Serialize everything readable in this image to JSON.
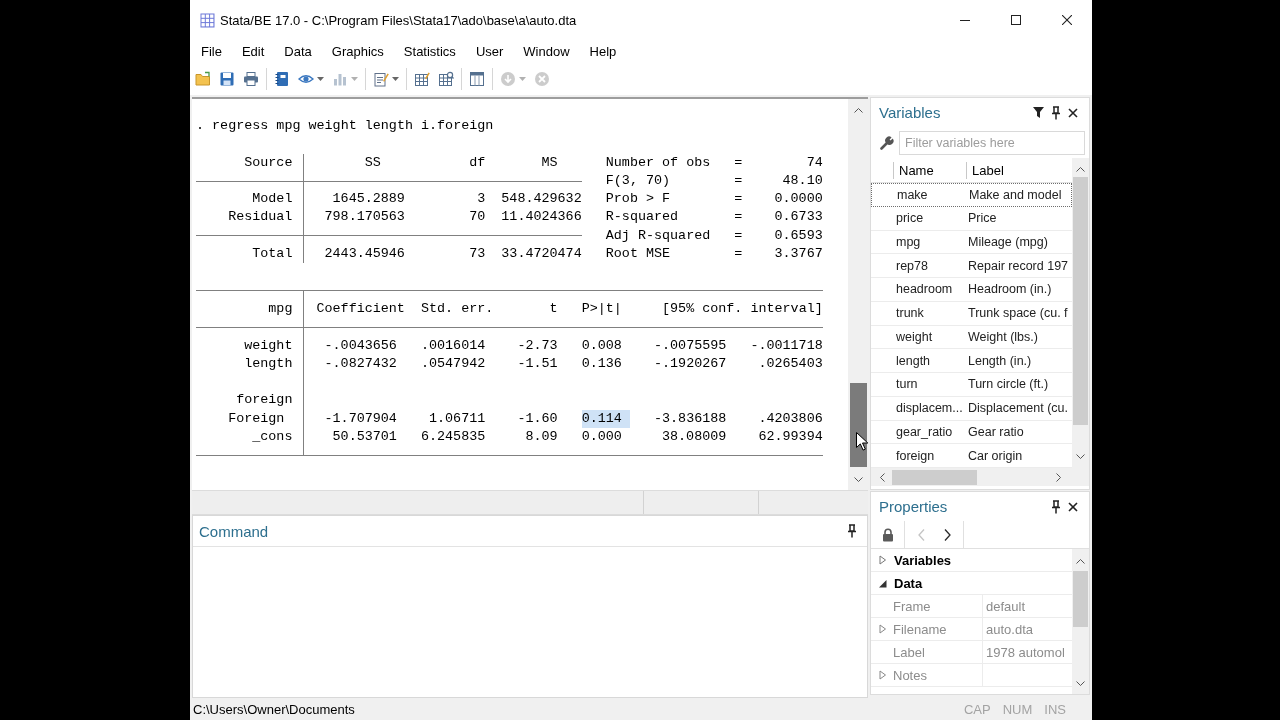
{
  "window": {
    "title": "Stata/BE 17.0 - C:\\Program Files\\Stata17\\ado\\base\\a\\auto.dta"
  },
  "menu": [
    "File",
    "Edit",
    "Data",
    "Graphics",
    "Statistics",
    "User",
    "Window",
    "Help"
  ],
  "toolbar": [
    [
      {
        "kind": "open",
        "dropdown": false,
        "disabled": false
      },
      {
        "kind": "save",
        "dropdown": false,
        "disabled": false
      },
      {
        "kind": "print",
        "dropdown": false,
        "disabled": false
      }
    ],
    [
      {
        "kind": "log",
        "dropdown": false,
        "disabled": false
      },
      {
        "kind": "viewer",
        "dropdown": true,
        "disabled": false
      },
      {
        "kind": "graph",
        "dropdown": true,
        "disabled": true
      }
    ],
    [
      {
        "kind": "do_file",
        "dropdown": true,
        "disabled": false
      }
    ],
    [
      {
        "kind": "data_editor",
        "dropdown": false,
        "disabled": false
      },
      {
        "kind": "data_browser",
        "dropdown": false,
        "disabled": false
      }
    ],
    [
      {
        "kind": "variables_manager",
        "dropdown": false,
        "disabled": false
      }
    ],
    [
      {
        "kind": "break",
        "dropdown": true,
        "disabled": true
      },
      {
        "kind": "stop",
        "dropdown": false,
        "disabled": true
      }
    ]
  ],
  "results": {
    "command": ". regress mpg weight length i.foreign",
    "anova": {
      "columns": [
        "Source",
        "SS",
        "df",
        "MS"
      ],
      "rows": [
        {
          "source": "Model",
          "ss": "1645.2889",
          "df": "3",
          "ms": "548.429632"
        },
        {
          "source": "Residual",
          "ss": "798.170563",
          "df": "70",
          "ms": "11.4024366"
        }
      ],
      "total": {
        "source": "Total",
        "ss": "2443.45946",
        "df": "73",
        "ms": "33.4720474"
      }
    },
    "fit_stats": [
      {
        "label": "Number of obs",
        "sign": "=",
        "value": "74"
      },
      {
        "label": "F(3, 70)",
        "sign": "=",
        "value": "48.10"
      },
      {
        "label": "Prob > F",
        "sign": "=",
        "value": "0.0000"
      },
      {
        "label": "R-squared",
        "sign": "=",
        "value": "0.6733"
      },
      {
        "label": "Adj R-squared",
        "sign": "=",
        "value": "0.6593"
      },
      {
        "label": "Root MSE",
        "sign": "=",
        "value": "3.3767"
      }
    ],
    "coefficients": {
      "columns": [
        "mpg",
        "Coefficient",
        "Std. err.",
        "t",
        "P>|t|",
        "[95% conf. interval]"
      ],
      "rows": [
        {
          "label": "weight",
          "cells": [
            {
              "text": "-.0043656",
              "selected": false
            },
            {
              "text": ".0016014",
              "selected": false
            },
            {
              "text": "-2.73",
              "selected": false
            },
            {
              "text": "0.008",
              "selected": false
            },
            {
              "text": "-.0075595",
              "selected": false
            },
            {
              "text": "-.0011718",
              "selected": false
            }
          ]
        },
        {
          "label": "length",
          "cells": [
            {
              "text": "-.0827432",
              "selected": false
            },
            {
              "text": ".0547942",
              "selected": false
            },
            {
              "text": "-1.51",
              "selected": false
            },
            {
              "text": "0.136",
              "selected": false
            },
            {
              "text": "-.1920267",
              "selected": false
            },
            {
              "text": ".0265403",
              "selected": false
            }
          ]
        },
        {
          "label": "foreign",
          "children": [
            {
              "label": "Foreign",
              "cells": [
                {
                  "text": "-1.707904",
                  "selected": false
                },
                {
                  "text": "1.06711",
                  "selected": false
                },
                {
                  "text": "-1.60",
                  "selected": false
                },
                {
                  "text": "0.114",
                  "selected": true
                },
                {
                  "text": "-3.836188",
                  "selected": false
                },
                {
                  "text": ".4203806",
                  "selected": false
                }
              ]
            }
          ]
        },
        {
          "label": "_cons",
          "cells": [
            {
              "text": "50.53701",
              "selected": false
            },
            {
              "text": "6.245835",
              "selected": false
            },
            {
              "text": "8.09",
              "selected": false
            },
            {
              "text": "0.000",
              "selected": false
            },
            {
              "text": "38.08009",
              "selected": false
            },
            {
              "text": "62.99394",
              "selected": false
            }
          ]
        }
      ]
    }
  },
  "command_window": {
    "title": "Command"
  },
  "variables_panel": {
    "title": "Variables",
    "filter": {
      "placeholder": "Filter variables here"
    },
    "columns": [
      "Name",
      "Label"
    ],
    "rows": [
      {
        "name": "make",
        "label": "Make and model",
        "selected": true
      },
      {
        "name": "price",
        "label": "Price",
        "selected": false
      },
      {
        "name": "mpg",
        "label": "Mileage (mpg)",
        "selected": false
      },
      {
        "name": "rep78",
        "label": "Repair record 197",
        "selected": false
      },
      {
        "name": "headroom",
        "label": "Headroom (in.)",
        "selected": false
      },
      {
        "name": "trunk",
        "label": "Trunk space (cu. f",
        "selected": false
      },
      {
        "name": "weight",
        "label": "Weight (lbs.)",
        "selected": false
      },
      {
        "name": "length",
        "label": "Length (in.)",
        "selected": false
      },
      {
        "name": "turn",
        "label": "Turn circle (ft.)",
        "selected": false
      },
      {
        "name": "displacem...",
        "label": "Displacement (cu.",
        "selected": false
      },
      {
        "name": "gear_ratio",
        "label": "Gear ratio",
        "selected": false
      },
      {
        "name": "foreign",
        "label": "Car origin",
        "selected": false
      }
    ]
  },
  "properties_panel": {
    "title": "Properties",
    "nav": [
      {
        "kind": "back",
        "disabled": true
      },
      {
        "kind": "forward",
        "disabled": false
      }
    ],
    "sections": [
      {
        "label": "Variables",
        "expanded": false
      },
      {
        "label": "Data",
        "expanded": true,
        "children": [
          {
            "name": "Frame",
            "value": "default"
          },
          {
            "name": "Filename",
            "value": "auto.dta",
            "expanded": false
          },
          {
            "name": "Label",
            "value": "1978 automol"
          },
          {
            "name": "Notes",
            "expanded": false
          }
        ]
      }
    ]
  },
  "status_bar": {
    "path": "C:\\Users\\Owner\\Documents",
    "indicators": [
      {
        "label": "CAP",
        "on": false
      },
      {
        "label": "NUM",
        "on": false
      },
      {
        "label": "INS",
        "on": false
      }
    ]
  }
}
